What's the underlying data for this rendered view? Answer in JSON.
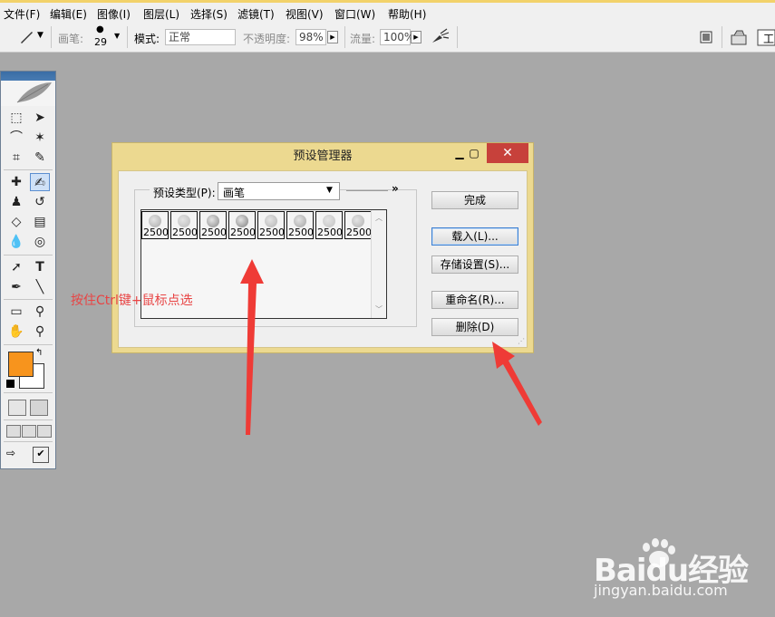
{
  "menubar": {
    "items": [
      "文件(F)",
      "编辑(E)",
      "图像(I)",
      "图层(L)",
      "选择(S)",
      "滤镜(T)",
      "视图(V)",
      "窗口(W)",
      "帮助(H)"
    ]
  },
  "options": {
    "brush_label": "画笔:",
    "brush_size": "29",
    "mode_label": "模式:",
    "mode_value": "正常",
    "opacity_label": "不透明度:",
    "opacity_value": "98%",
    "flow_label": "流量:",
    "flow_value": "100%"
  },
  "dialog": {
    "title": "预设管理器",
    "preset_type_label": "预设类型(P):",
    "preset_type_value": "画笔",
    "more_glyph": "»",
    "presets": [
      "2500",
      "2500",
      "2500",
      "2500",
      "2500",
      "2500",
      "2500",
      "2500"
    ],
    "buttons": {
      "done": "完成",
      "load": "载入(L)...",
      "save": "存储设置(S)...",
      "rename": "重命名(R)...",
      "delete": "删除(D)"
    }
  },
  "annotation": {
    "text": "按住Ctrl键+鼠标点选"
  },
  "watermark": {
    "brand": "Baidu经验",
    "url": "jingyan.baidu.com"
  },
  "colors": {
    "foreground": "#f7941d",
    "background": "#ffffff",
    "arrow": "#ef3b36",
    "dialog_frame": "#ecd990",
    "close_button": "#c7413b"
  },
  "icons": [
    "brush-tool-icon",
    "marquee-icon",
    "move-icon",
    "lasso-icon",
    "magic-wand-icon",
    "crop-icon",
    "slice-icon",
    "healing-icon",
    "brush-icon",
    "stamp-icon",
    "history-brush-icon",
    "eraser-icon",
    "gradient-icon",
    "blur-icon",
    "dodge-icon",
    "path-select-icon",
    "type-icon",
    "pen-icon",
    "line-icon",
    "notes-icon",
    "eyedropper-icon",
    "hand-icon",
    "zoom-icon"
  ]
}
